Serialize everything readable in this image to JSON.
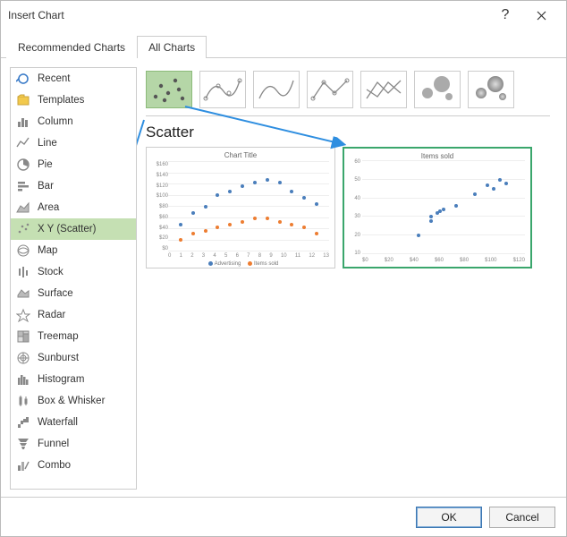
{
  "titlebar": {
    "title": "Insert Chart"
  },
  "tabs": {
    "recommended": "Recommended Charts",
    "all": "All Charts"
  },
  "tree": {
    "items": [
      {
        "label": "Recent"
      },
      {
        "label": "Templates"
      },
      {
        "label": "Column"
      },
      {
        "label": "Line"
      },
      {
        "label": "Pie"
      },
      {
        "label": "Bar"
      },
      {
        "label": "Area"
      },
      {
        "label": "X Y (Scatter)"
      },
      {
        "label": "Map"
      },
      {
        "label": "Stock"
      },
      {
        "label": "Surface"
      },
      {
        "label": "Radar"
      },
      {
        "label": "Treemap"
      },
      {
        "label": "Sunburst"
      },
      {
        "label": "Histogram"
      },
      {
        "label": "Box & Whisker"
      },
      {
        "label": "Waterfall"
      },
      {
        "label": "Funnel"
      },
      {
        "label": "Combo"
      }
    ],
    "selected_index": 7
  },
  "subtype_title": "Scatter",
  "previews": {
    "left": {
      "title": "Chart Title",
      "legend": {
        "a": "Advertising",
        "b": "Items sold"
      }
    },
    "right": {
      "title": "Items sold"
    }
  },
  "buttons": {
    "ok": "OK",
    "cancel": "Cancel"
  },
  "colors": {
    "series_a": "#4a7ebb",
    "series_b": "#ed7d31",
    "accent": "#3aa66c"
  },
  "chart_data": [
    {
      "type": "scatter",
      "title": "Chart Title",
      "xlabel": "",
      "ylabel": "",
      "xlim": [
        0,
        13
      ],
      "ylim": [
        0,
        150
      ],
      "x_ticks": [
        0,
        1,
        2,
        3,
        4,
        5,
        6,
        7,
        8,
        9,
        10,
        11,
        12,
        13
      ],
      "y_ticks": [
        "$0",
        "$20",
        "$40",
        "$60",
        "$80",
        "$100",
        "$120",
        "$140",
        "$160"
      ],
      "series": [
        {
          "name": "Advertising",
          "color": "#4a7ebb",
          "x": [
            1,
            2,
            3,
            4,
            5,
            6,
            7,
            8,
            9,
            10,
            11,
            12
          ],
          "y": [
            45,
            65,
            75,
            95,
            100,
            110,
            115,
            120,
            115,
            100,
            90,
            80
          ]
        },
        {
          "name": "Items sold",
          "color": "#ed7d31",
          "x": [
            1,
            2,
            3,
            4,
            5,
            6,
            7,
            8,
            9,
            10,
            11,
            12
          ],
          "y": [
            20,
            30,
            35,
            40,
            45,
            50,
            55,
            55,
            50,
            45,
            40,
            30
          ]
        }
      ]
    },
    {
      "type": "scatter",
      "title": "Items sold",
      "xlabel": "",
      "ylabel": "",
      "xlim": [
        0,
        130
      ],
      "ylim": [
        10,
        60
      ],
      "x_ticks": [
        "$0",
        "$20",
        "$40",
        "$60",
        "$80",
        "$100",
        "$120"
      ],
      "y_ticks": [
        10,
        20,
        30,
        40,
        50,
        60
      ],
      "series": [
        {
          "name": "Items sold",
          "color": "#4a7ebb",
          "x": [
            45,
            55,
            55,
            60,
            62,
            65,
            75,
            90,
            100,
            105,
            110,
            115
          ],
          "y": [
            20,
            28,
            30,
            32,
            33,
            34,
            36,
            42,
            47,
            45,
            50,
            48
          ]
        }
      ]
    }
  ]
}
